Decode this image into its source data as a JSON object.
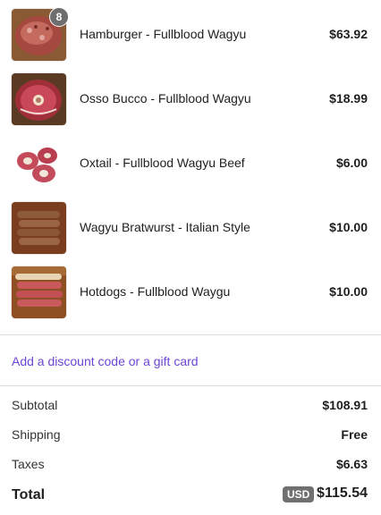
{
  "cart": {
    "items": [
      {
        "name": "Hamburger - Fullblood Wagyu",
        "price": "$63.92",
        "quantity": "8",
        "image": "ground-beef-image"
      },
      {
        "name": "Osso Bucco - Fullblood Wagyu",
        "price": "$18.99",
        "image": "osso-bucco-image"
      },
      {
        "name": "Oxtail - Fullblood Wagyu Beef",
        "price": "$6.00",
        "image": "oxtail-image"
      },
      {
        "name": "Wagyu Bratwurst - Italian Style",
        "price": "$10.00",
        "image": "bratwurst-image"
      },
      {
        "name": "Hotdogs - Fullblood Waygu",
        "price": "$10.00",
        "image": "hotdogs-image"
      }
    ]
  },
  "discount": {
    "link_label": "Add a discount code or a gift card",
    "color": "#6b45d6"
  },
  "summary": {
    "subtotal_label": "Subtotal",
    "subtotal_value": "$108.91",
    "shipping_label": "Shipping",
    "shipping_value": "Free",
    "taxes_label": "Taxes",
    "taxes_value": "$6.63",
    "total_label": "Total",
    "currency": "USD",
    "total_value": "$115.54"
  }
}
